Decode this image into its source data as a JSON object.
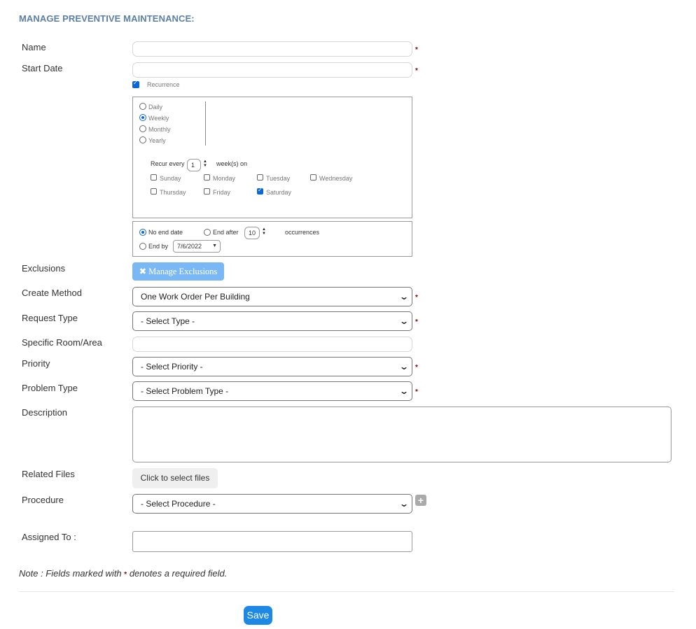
{
  "title": "MANAGE PREVENTIVE MAINTENANCE:",
  "required_mark": "*",
  "fields": {
    "name_label": "Name",
    "start_date_label": "Start Date",
    "recurrence_label": "Recurrence",
    "exclusions_label": "Exclusions",
    "create_method_label": "Create Method",
    "request_type_label": "Request Type",
    "specific_room_label": "Specific Room/Area",
    "priority_label": "Priority",
    "problem_type_label": "Problem Type",
    "description_label": "Description",
    "related_files_label": "Related Files",
    "procedure_label": "Procedure",
    "assigned_to_label": "Assigned To :"
  },
  "recurrence": {
    "checked": true,
    "patterns": [
      "Daily",
      "Weekly",
      "Monthly",
      "Yearly"
    ],
    "selected_pattern": "Weekly",
    "recur_every_label": "Recur every",
    "recur_every_value": "1",
    "weeks_on_label": "week(s) on",
    "days": [
      "Sunday",
      "Monday",
      "Tuesday",
      "Wednesday",
      "Thursday",
      "Friday",
      "Saturday"
    ],
    "checked_days": [
      "Saturday"
    ],
    "end": {
      "no_end_label": "No end date",
      "end_after_label": "End after",
      "occurrences_value": "10",
      "occurrences_label": "occurrences",
      "end_by_label": "End by",
      "end_by_date": "7/6/2022",
      "selected": "No end date"
    }
  },
  "buttons": {
    "manage_exclusions": "✖ Manage Exclusions",
    "select_files": "Click to select files",
    "save": "Save",
    "add_procedure": "+"
  },
  "selects": {
    "create_method": "One Work Order Per Building",
    "request_type": "- Select Type -",
    "priority": "- Select Priority -",
    "problem_type": "- Select Problem Type -",
    "procedure": "- Select Procedure -"
  },
  "note": {
    "prefix": "Note : Fields marked with",
    "suffix": "denotes a required field."
  },
  "colors": {
    "title": "#5b7fa6",
    "required": "#8b0000",
    "accent": "#1e88e5",
    "exclusions_button": "#7ab8f5"
  }
}
